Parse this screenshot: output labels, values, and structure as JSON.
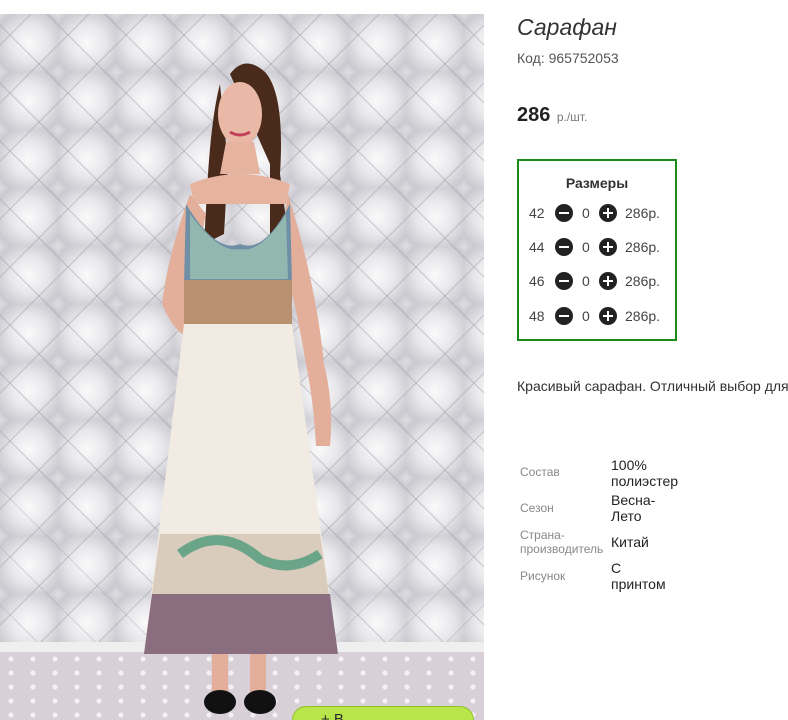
{
  "product": {
    "title": "Сарафан",
    "code_label": "Код:",
    "code_value": "965752053",
    "price": "286",
    "price_unit": "р./шт."
  },
  "sizes": {
    "title": "Размеры",
    "rows": [
      {
        "size": "42",
        "qty": "0",
        "price": "286р."
      },
      {
        "size": "44",
        "qty": "0",
        "price": "286р."
      },
      {
        "size": "46",
        "qty": "0",
        "price": "286р."
      },
      {
        "size": "48",
        "qty": "0",
        "price": "286р."
      }
    ],
    "border_color": "#1a8a1a"
  },
  "description": "Красивый сарафан. Отличный выбор для",
  "properties": [
    {
      "label": "Состав",
      "value_lines": [
        "100%",
        "полиэстер"
      ]
    },
    {
      "label": "Сезон",
      "value_lines": [
        "Весна-",
        "Лето"
      ]
    },
    {
      "label_lines": [
        "Страна-",
        "производитель"
      ],
      "value_lines": [
        "Китай"
      ]
    },
    {
      "label": "Рисунок",
      "value_lines": [
        "С",
        "принтом"
      ]
    }
  ],
  "cart_button": {
    "label": "+ В..."
  },
  "colors": {
    "accent_green": "#b7e54a"
  }
}
